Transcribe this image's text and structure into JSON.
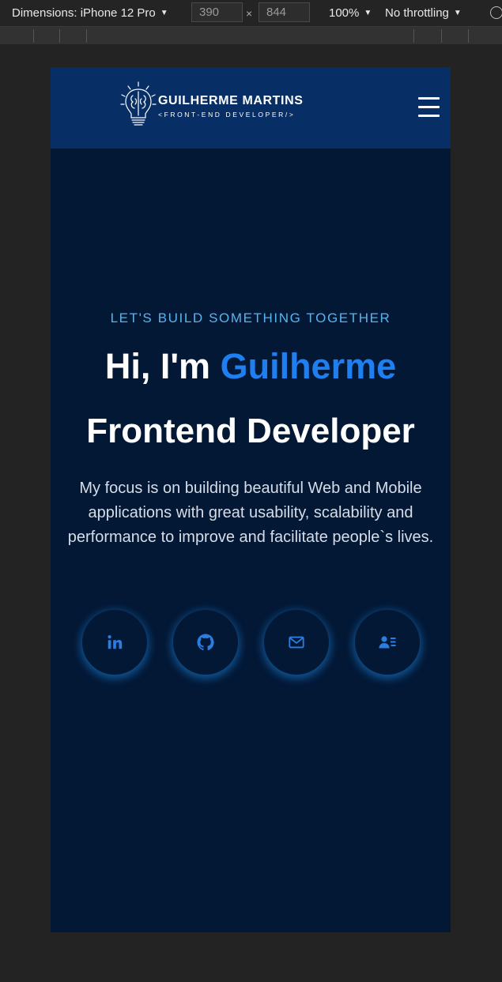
{
  "devtools": {
    "dimensions_label": "Dimensions: iPhone 12 Pro",
    "width_value": "390",
    "separator": "×",
    "height_value": "844",
    "zoom": "100%",
    "throttling": "No throttling"
  },
  "header": {
    "logo_name": "GUILHERME MARTINS",
    "logo_tagline": "<FRONT-END DEVELOPER/>",
    "menu_icon": "hamburger-icon"
  },
  "hero": {
    "eyebrow": "LET'S BUILD SOMETHING TOGETHER",
    "greeting_prefix": "Hi, I'm ",
    "greeting_name": "Guilherme",
    "role": "Frontend Developer",
    "description": "My focus is on building beautiful Web and Mobile applications with great usability, scalability and performance to improve and facilitate people`s lives."
  },
  "social": [
    {
      "name": "linkedin",
      "icon": "linkedin-icon"
    },
    {
      "name": "github",
      "icon": "github-icon"
    },
    {
      "name": "email",
      "icon": "mail-icon"
    },
    {
      "name": "resume",
      "icon": "contact-card-icon"
    }
  ],
  "colors": {
    "page_bg": "#031835",
    "nav_bg": "#072f66",
    "accent": "#1f7ff0",
    "eyebrow": "#58b4ee",
    "icon": "#2a7de1"
  }
}
